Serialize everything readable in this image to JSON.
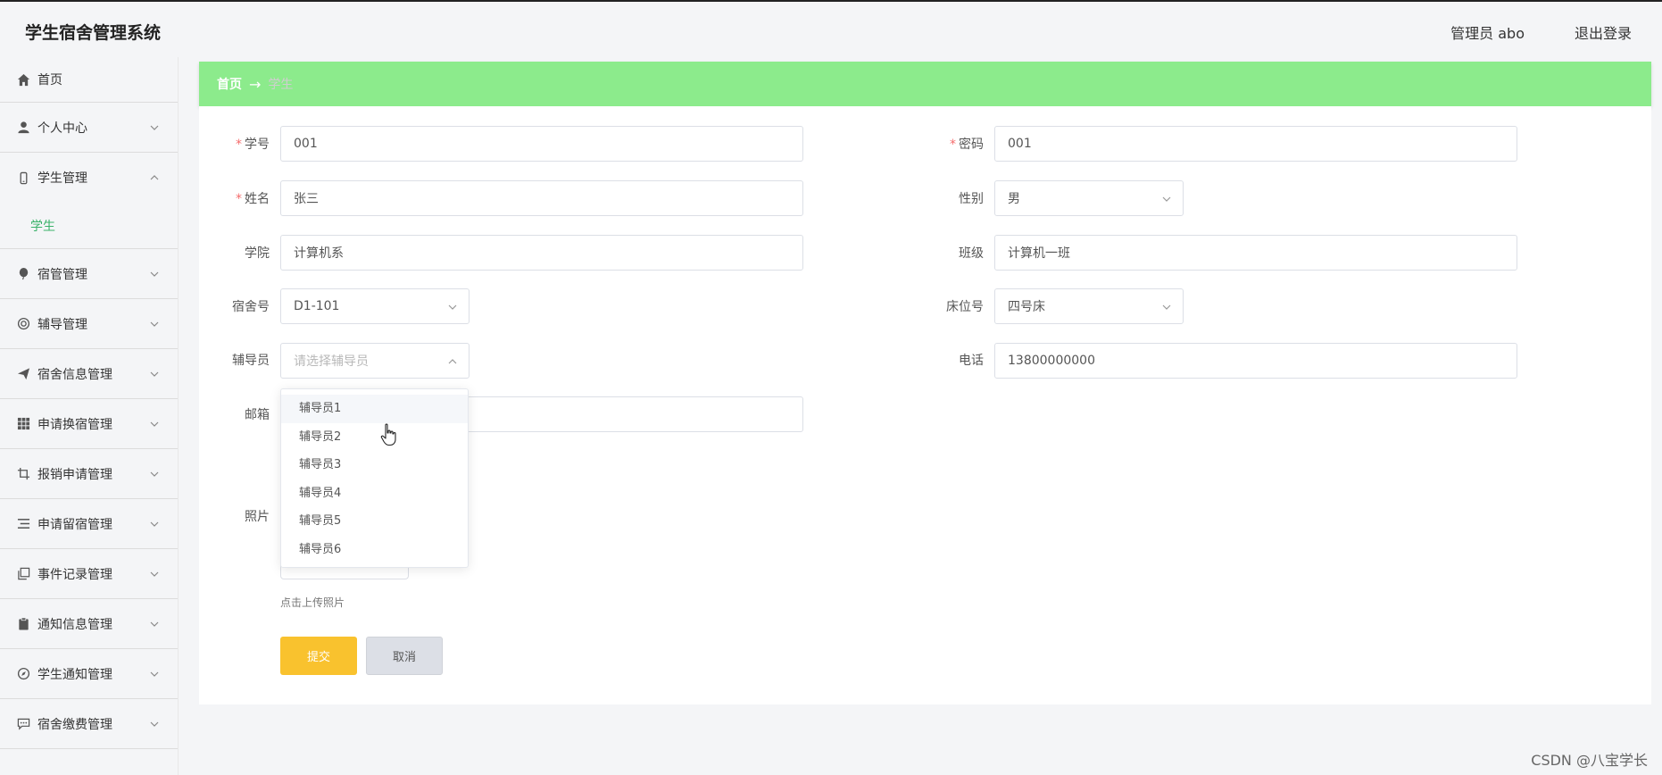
{
  "header": {
    "app_title": "学生宿舍管理系统",
    "user_info": "管理员 abo",
    "logout": "退出登录"
  },
  "sidebar": {
    "items": [
      {
        "label": "首页",
        "icon": "home-icon"
      },
      {
        "label": "个人中心",
        "icon": "user-icon"
      },
      {
        "label": "学生管理",
        "icon": "phone-icon",
        "expanded": true,
        "children": [
          {
            "label": "学生"
          }
        ]
      },
      {
        "label": "宿管管理",
        "icon": "balloon-icon"
      },
      {
        "label": "辅导管理",
        "icon": "lifebuoy-icon"
      },
      {
        "label": "宿舍信息管理",
        "icon": "send-icon"
      },
      {
        "label": "申请换宿管理",
        "icon": "grid-icon"
      },
      {
        "label": "报销申请管理",
        "icon": "crop-icon"
      },
      {
        "label": "申请留宿管理",
        "icon": "list-icon"
      },
      {
        "label": "事件记录管理",
        "icon": "copy-icon"
      },
      {
        "label": "通知信息管理",
        "icon": "clipboard-icon"
      },
      {
        "label": "学生通知管理",
        "icon": "compass-icon"
      },
      {
        "label": "宿舍缴费管理",
        "icon": "chat-icon"
      }
    ]
  },
  "breadcrumb": {
    "home": "首页",
    "arrow": "→",
    "current": "学生"
  },
  "form": {
    "student_id": {
      "label": "学号",
      "value": "001",
      "required": true
    },
    "password": {
      "label": "密码",
      "value": "001",
      "required": true
    },
    "name": {
      "label": "姓名",
      "value": "张三",
      "required": true
    },
    "gender": {
      "label": "性别",
      "value": "男"
    },
    "college": {
      "label": "学院",
      "value": "计算机系"
    },
    "class": {
      "label": "班级",
      "value": "计算机一班"
    },
    "dorm_no": {
      "label": "宿舍号",
      "value": "D1-101"
    },
    "bed_no": {
      "label": "床位号",
      "value": "四号床"
    },
    "counselor": {
      "label": "辅导员",
      "placeholder": "请选择辅导员"
    },
    "phone": {
      "label": "电话",
      "value": "13800000000"
    },
    "email": {
      "label": "邮箱"
    },
    "photo": {
      "label": "照片",
      "tip": "点击上传照片"
    },
    "required_mark": "*"
  },
  "counselor_dropdown": {
    "options": [
      "辅导员1",
      "辅导员2",
      "辅导员3",
      "辅导员4",
      "辅导员5",
      "辅导员6"
    ],
    "hovered_index": 0
  },
  "buttons": {
    "submit": "提交",
    "cancel": "取消"
  },
  "watermark": "CSDN @八宝学长",
  "colors": {
    "breadcrumb_bg": "#8ceb8c",
    "submit_bg": "#f9c22e",
    "active_submenu": "#3bb26a",
    "required": "#f56c6c"
  }
}
